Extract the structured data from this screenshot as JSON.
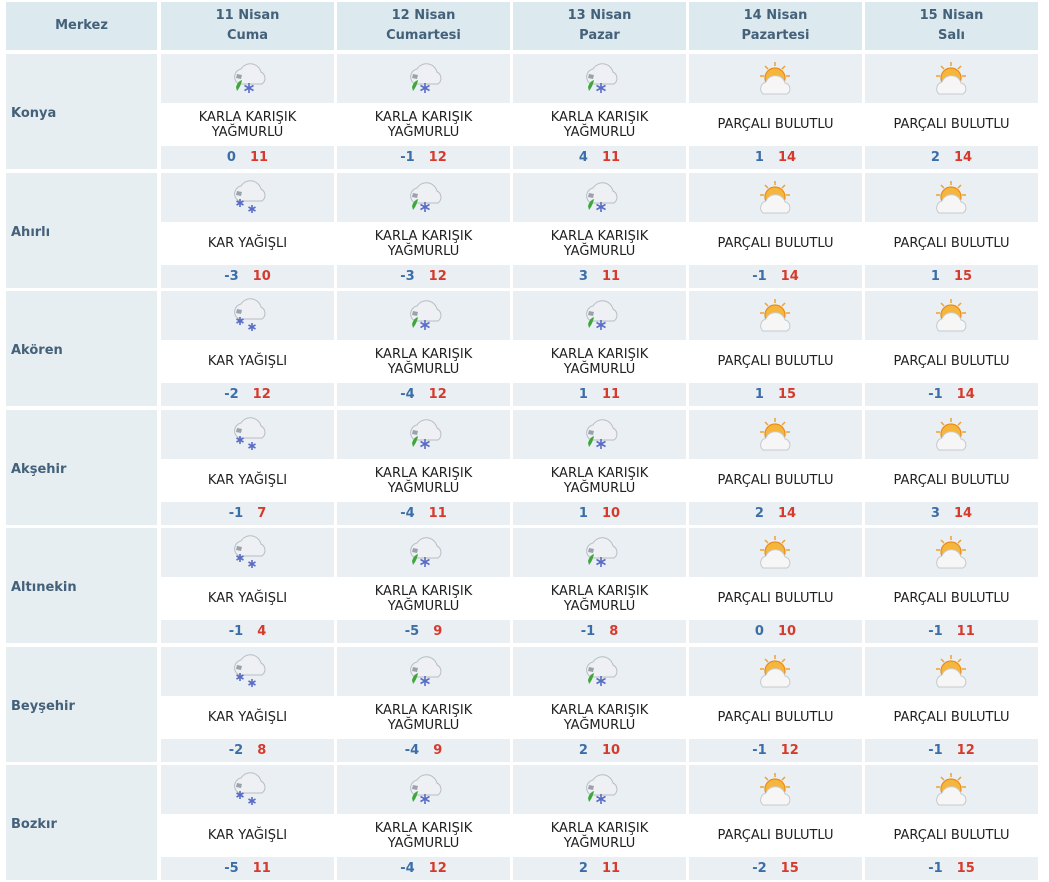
{
  "header": {
    "merkez": "Merkez",
    "days": [
      {
        "date": "11 Nisan",
        "weekday": "Cuma"
      },
      {
        "date": "12 Nisan",
        "weekday": "Cumartesi"
      },
      {
        "date": "13 Nisan",
        "weekday": "Pazar"
      },
      {
        "date": "14 Nisan",
        "weekday": "Pazartesi"
      },
      {
        "date": "15 Nisan",
        "weekday": "Salı"
      }
    ]
  },
  "conditions": {
    "sleet": "KARLA KARIŞIK YAĞMURLU",
    "snow": "KAR YAĞIŞLI",
    "partly_cloudy": "PARÇALI BULUTLU"
  },
  "icons": {
    "sleet": "sleet-icon",
    "snow": "snow-icon",
    "partly_cloudy": "partly-cloudy-icon"
  },
  "colors": {
    "low_temp": "#3b6ea8",
    "high_temp": "#d63a2c",
    "header_bg": "#dce9ef",
    "header_text": "#44617a"
  },
  "cities": [
    {
      "name": "Konya",
      "days": [
        {
          "cond": "sleet",
          "low": "0",
          "high": "11"
        },
        {
          "cond": "sleet",
          "low": "-1",
          "high": "12"
        },
        {
          "cond": "sleet",
          "low": "4",
          "high": "11"
        },
        {
          "cond": "partly_cloudy",
          "low": "1",
          "high": "14"
        },
        {
          "cond": "partly_cloudy",
          "low": "2",
          "high": "14"
        }
      ]
    },
    {
      "name": "Ahırlı",
      "days": [
        {
          "cond": "snow",
          "low": "-3",
          "high": "10"
        },
        {
          "cond": "sleet",
          "low": "-3",
          "high": "12"
        },
        {
          "cond": "sleet",
          "low": "3",
          "high": "11"
        },
        {
          "cond": "partly_cloudy",
          "low": "-1",
          "high": "14"
        },
        {
          "cond": "partly_cloudy",
          "low": "1",
          "high": "15"
        }
      ]
    },
    {
      "name": "Akören",
      "days": [
        {
          "cond": "snow",
          "low": "-2",
          "high": "12"
        },
        {
          "cond": "sleet",
          "low": "-4",
          "high": "12"
        },
        {
          "cond": "sleet",
          "low": "1",
          "high": "11"
        },
        {
          "cond": "partly_cloudy",
          "low": "1",
          "high": "15"
        },
        {
          "cond": "partly_cloudy",
          "low": "-1",
          "high": "14"
        }
      ]
    },
    {
      "name": "Akşehir",
      "days": [
        {
          "cond": "snow",
          "low": "-1",
          "high": "7"
        },
        {
          "cond": "sleet",
          "low": "-4",
          "high": "11"
        },
        {
          "cond": "sleet",
          "low": "1",
          "high": "10"
        },
        {
          "cond": "partly_cloudy",
          "low": "2",
          "high": "14"
        },
        {
          "cond": "partly_cloudy",
          "low": "3",
          "high": "14"
        }
      ]
    },
    {
      "name": "Altınekin",
      "days": [
        {
          "cond": "snow",
          "low": "-1",
          "high": "4"
        },
        {
          "cond": "sleet",
          "low": "-5",
          "high": "9"
        },
        {
          "cond": "sleet",
          "low": "-1",
          "high": "8"
        },
        {
          "cond": "partly_cloudy",
          "low": "0",
          "high": "10"
        },
        {
          "cond": "partly_cloudy",
          "low": "-1",
          "high": "11"
        }
      ]
    },
    {
      "name": "Beyşehir",
      "days": [
        {
          "cond": "snow",
          "low": "-2",
          "high": "8"
        },
        {
          "cond": "sleet",
          "low": "-4",
          "high": "9"
        },
        {
          "cond": "sleet",
          "low": "2",
          "high": "10"
        },
        {
          "cond": "partly_cloudy",
          "low": "-1",
          "high": "12"
        },
        {
          "cond": "partly_cloudy",
          "low": "-1",
          "high": "12"
        }
      ]
    },
    {
      "name": "Bozkır",
      "days": [
        {
          "cond": "snow",
          "low": "-5",
          "high": "11"
        },
        {
          "cond": "sleet",
          "low": "-4",
          "high": "12"
        },
        {
          "cond": "sleet",
          "low": "2",
          "high": "11"
        },
        {
          "cond": "partly_cloudy",
          "low": "-2",
          "high": "15"
        },
        {
          "cond": "partly_cloudy",
          "low": "-1",
          "high": "15"
        }
      ]
    }
  ]
}
